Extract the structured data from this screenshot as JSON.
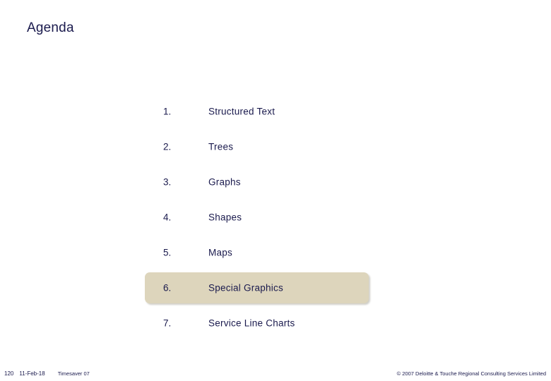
{
  "slide": {
    "title": "Agenda",
    "background_color": "#ffffff",
    "text_color": "#1a1a4d",
    "highlight_color": "#ddd5bc"
  },
  "agenda": {
    "items": [
      {
        "number": "1.",
        "label": "Structured Text",
        "highlighted": false
      },
      {
        "number": "2.",
        "label": "Trees",
        "highlighted": false
      },
      {
        "number": "3.",
        "label": "Graphs",
        "highlighted": false
      },
      {
        "number": "4.",
        "label": "Shapes",
        "highlighted": false
      },
      {
        "number": "5.",
        "label": "Maps",
        "highlighted": false
      },
      {
        "number": "6.",
        "label": "Special Graphics",
        "highlighted": true
      },
      {
        "number": "7.",
        "label": "Service Line Charts",
        "highlighted": false
      }
    ]
  },
  "footer": {
    "page_number": "120",
    "date": "11-Feb-18",
    "deck_name": "Timesaver 07",
    "copyright": "© 2007 Deloitte & Touche Regional Consulting Services Limited"
  }
}
